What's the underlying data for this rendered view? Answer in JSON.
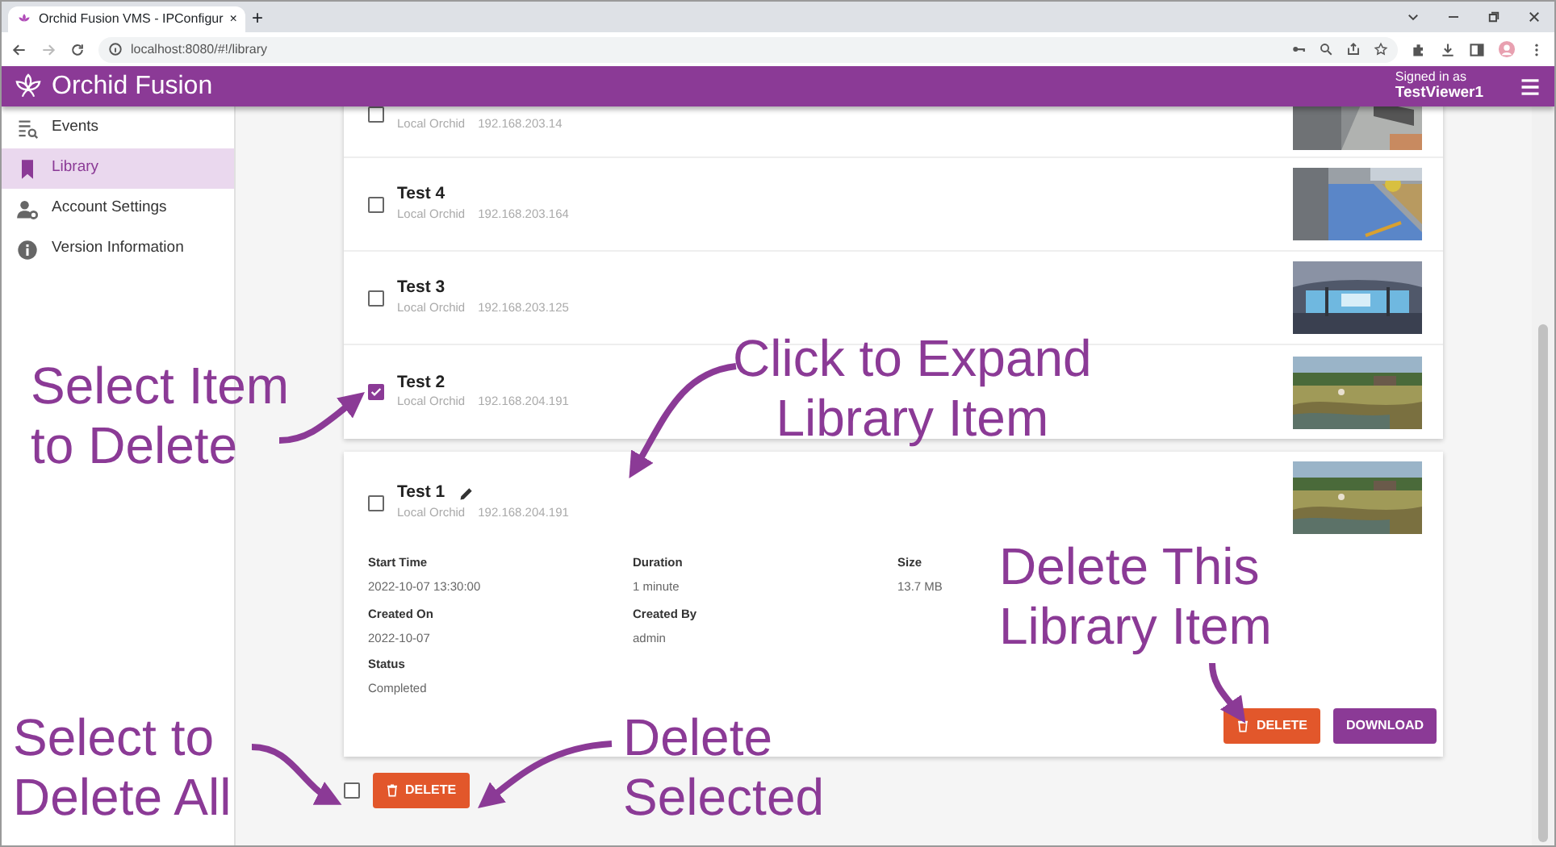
{
  "browser": {
    "tab_title": "Orchid Fusion VMS - IPConfigur",
    "tab_close": "×",
    "new_tab": "+",
    "url": "localhost:8080/#!/library"
  },
  "app_bar": {
    "title": "Orchid Fusion",
    "signed_in_label": "Signed in as",
    "user": "TestViewer1"
  },
  "sidebar": {
    "items": [
      {
        "label": "Events",
        "selected": false
      },
      {
        "label": "Library",
        "selected": true
      },
      {
        "label": "Account Settings",
        "selected": false
      },
      {
        "label": "Version Information",
        "selected": false
      }
    ]
  },
  "library": {
    "items": [
      {
        "source": "Local Orchid",
        "address": "192.168.203.14",
        "checked": false,
        "kind": "row"
      },
      {
        "title": "Test 4",
        "source": "Local Orchid",
        "address": "192.168.203.164",
        "checked": false,
        "kind": "row"
      },
      {
        "title": "Test 3",
        "source": "Local Orchid",
        "address": "192.168.203.125",
        "checked": false,
        "kind": "row"
      },
      {
        "title": "Test 2",
        "source": "Local Orchid",
        "address": "192.168.204.191",
        "checked": true,
        "kind": "row"
      },
      {
        "title": "Test 1",
        "source": "Local Orchid",
        "address": "192.168.204.191",
        "checked": false,
        "kind": "expanded",
        "details": [
          {
            "label": "Start Time",
            "value": "2022-10-07 13:30:00"
          },
          {
            "label": "Duration",
            "value": "1 minute"
          },
          {
            "label": "Size",
            "value": "13.7 MB"
          },
          {
            "label": "Created On",
            "value": "2022-10-07"
          },
          {
            "label": "Created By",
            "value": "admin"
          },
          {
            "label": "Status",
            "value": "Completed"
          }
        ],
        "actions": [
          {
            "label": "DELETE",
            "kind": "delete"
          },
          {
            "label": "DOWNLOAD",
            "kind": "download"
          }
        ]
      }
    ]
  },
  "footer": {
    "select_all_checked": false,
    "delete_label": "DELETE"
  },
  "annotations": [
    {
      "lines": [
        "Select Item",
        "to Delete"
      ],
      "kind": "left"
    },
    {
      "lines": [
        "Click to Expand",
        "Library Item"
      ],
      "kind": "expand"
    },
    {
      "lines": [
        "Delete This",
        "Library Item"
      ],
      "kind": "this"
    },
    {
      "lines": [
        "Select to",
        "Delete All"
      ],
      "kind": "all"
    },
    {
      "lines": [
        "Delete",
        "Selected"
      ],
      "kind": "selected"
    }
  ]
}
